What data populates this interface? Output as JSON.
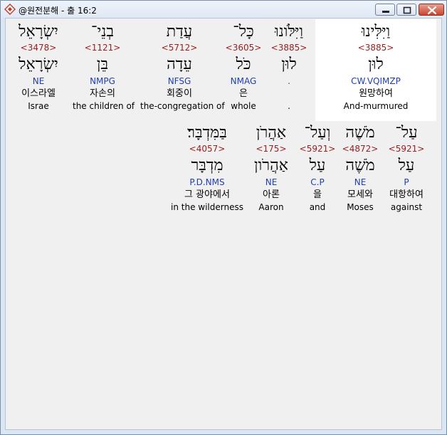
{
  "window": {
    "title": "@원전분해 - 출 16:2",
    "app_icon": "bible-app-icon",
    "controls": [
      "minimize-button",
      "maximize-button",
      "close-button"
    ]
  },
  "selected_word": "וַיִּלִּינוּ",
  "rows": [
    {
      "words": [
        {
          "heb": "וַיִּלִּינוּ",
          "strong": "<3885>",
          "lemma": "לוּן",
          "morph": "CW.VQIMZP",
          "kor": "원망하여",
          "eng": "And-murmured",
          "selected": true
        },
        {
          "heb": "וַיִּלֹּונוּ",
          "strong": "<3885>",
          "lemma": "לוּן",
          "morph": ".",
          "kor": "",
          "eng": "."
        },
        {
          "heb": "כָּל־",
          "strong": "<3605>",
          "lemma": "כֹּל",
          "morph": "NMAG",
          "kor": "은",
          "eng": "whole"
        },
        {
          "heb": "עֲדַת",
          "strong": "<5712>",
          "lemma": "עֵדָה",
          "morph": "NFSG",
          "kor": "회중이",
          "eng": "the-congregation of"
        },
        {
          "heb": "בְנֵי־",
          "strong": "<1121>",
          "lemma": "בֵּן",
          "morph": "NMPG",
          "kor": "자손의",
          "eng": "the children of"
        },
        {
          "heb": "יִשְׂרָאֵל",
          "strong": "<3478>",
          "lemma": "יִשְׂרָאֵל",
          "morph": "NE",
          "kor": "이스라엘",
          "eng": "Israe"
        }
      ]
    },
    {
      "words": [
        {
          "heb": "עַל־",
          "strong": "<5921>",
          "lemma": "עַל",
          "morph": "P",
          "kor": "대항하여",
          "eng": "against"
        },
        {
          "heb": "מֹשֶׁה",
          "strong": "<4872>",
          "lemma": "מֹשֶׁה",
          "morph": "NE",
          "kor": "모세와",
          "eng": "Moses"
        },
        {
          "heb": "וְעַל־",
          "strong": "<5921>",
          "lemma": "עַל",
          "morph": "C.P",
          "kor": "을",
          "eng": "and"
        },
        {
          "heb": "אַהֲרֹן",
          "strong": "<175>",
          "lemma": "אַהֲרֹון",
          "morph": "NE",
          "kor": "아론",
          "eng": "Aaron"
        },
        {
          "heb": "בַּמִּדְבָּר׃",
          "strong": "<4057>",
          "lemma": "מִדְבָּר",
          "morph": "P.D.NMS",
          "kor": "그 광야에서",
          "eng": "in the wilderness"
        }
      ]
    }
  ]
}
